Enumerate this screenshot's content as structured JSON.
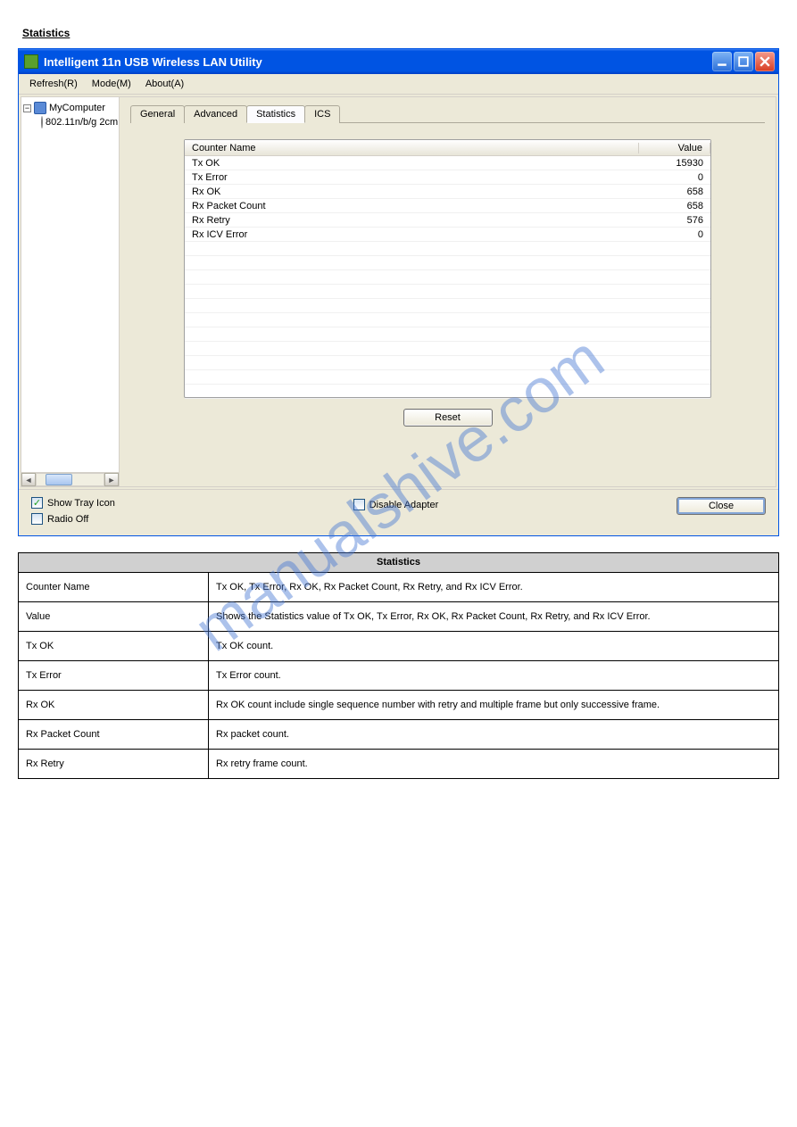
{
  "section_title": "Statistics",
  "window": {
    "title": "Intelligent 11n USB Wireless LAN Utility"
  },
  "menu": {
    "refresh": "Refresh(R)",
    "mode": "Mode(M)",
    "about": "About(A)"
  },
  "tree": {
    "root": "MyComputer",
    "child": "802.11n/b/g 2cm"
  },
  "tabs": {
    "general": "General",
    "advanced": "Advanced",
    "statistics": "Statistics",
    "ics": "ICS"
  },
  "stats": {
    "headers": {
      "name": "Counter Name",
      "value": "Value"
    },
    "rows": [
      {
        "name": "Tx OK",
        "value": "15930"
      },
      {
        "name": "Tx Error",
        "value": "0"
      },
      {
        "name": "Rx OK",
        "value": "658"
      },
      {
        "name": "Rx Packet Count",
        "value": "658"
      },
      {
        "name": "Rx Retry",
        "value": "576"
      },
      {
        "name": "Rx ICV Error",
        "value": "0"
      }
    ],
    "reset_label": "Reset"
  },
  "bottom": {
    "show_tray": "Show Tray Icon",
    "radio_off": "Radio Off",
    "disable_adapter": "Disable Adapter",
    "close": "Close"
  },
  "desc_table": {
    "header": "Statistics",
    "rows": [
      {
        "k": "Counter Name",
        "v": "Tx OK, Tx Error, Rx OK, Rx Packet Count, Rx Retry, and Rx ICV Error."
      },
      {
        "k": "Value",
        "v": "Shows the Statistics value of Tx OK, Tx Error, Rx OK, Rx Packet Count, Rx Retry, and Rx ICV Error."
      },
      {
        "k": "Tx OK",
        "v": "Tx OK count."
      },
      {
        "k": "Tx Error",
        "v": "Tx Error count."
      },
      {
        "k": "Rx OK",
        "v": "Rx OK count include single sequence number with retry and multiple frame but only successive frame."
      },
      {
        "k": "Rx Packet Count",
        "v": "Rx packet count."
      },
      {
        "k": "Rx Retry ",
        "v": "Rx retry frame count."
      }
    ]
  },
  "watermark": "manualshive.com"
}
